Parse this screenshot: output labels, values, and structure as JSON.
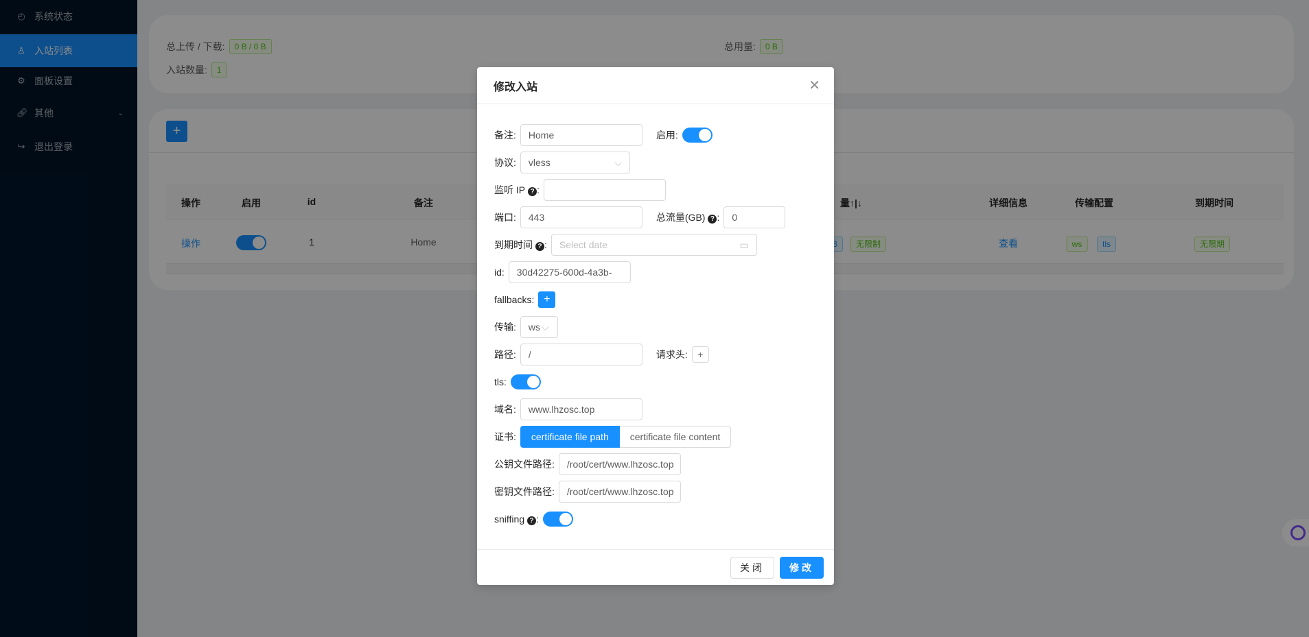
{
  "sidebar": {
    "items": [
      {
        "label": "系统状态",
        "icon": "dashboard-icon"
      },
      {
        "label": "入站列表",
        "icon": "user-icon",
        "selected": true
      },
      {
        "label": "面板设置",
        "icon": "gear-icon"
      },
      {
        "label": "其他",
        "icon": "link-icon"
      },
      {
        "label": "退出登录",
        "icon": "logout-icon"
      }
    ]
  },
  "stats": {
    "updown_label": "总上传 / 下载:",
    "updown_value": "0 B / 0 B",
    "count_label": "入站数量:",
    "count_value": "1",
    "total_label": "总用量:",
    "total_value": "0 B"
  },
  "table": {
    "headers": [
      "操作",
      "启用",
      "id",
      "备注",
      "量↑|↓",
      "详细信息",
      "传输配置",
      "到期时间"
    ],
    "row": {
      "action": "操作",
      "enabled": true,
      "id": "1",
      "remark": "Home",
      "traffic": "B",
      "limit": "无限制",
      "detail": "查看",
      "transport": "ws",
      "tls": "tls",
      "expiry": "无限期"
    }
  },
  "modal": {
    "title": "修改入站",
    "remark_label": "备注:",
    "remark": "Home",
    "enable_label": "启用:",
    "enabled": true,
    "protocol_label": "协议:",
    "protocol": "vless",
    "listen_label": "监听 IP",
    "listen": "",
    "port_label": "端口:",
    "port": "443",
    "total_label": "总流量(GB)",
    "total": "0",
    "expiry_label": "到期时间",
    "expiry_placeholder": "Select date",
    "id_label": "id:",
    "id": "30d42275-600d-4a3b-",
    "fallbacks_label": "fallbacks:",
    "transport_label": "传输:",
    "transport": "ws",
    "path_label": "路径:",
    "path": "/",
    "header_label": "请求头:",
    "tls_label": "tls:",
    "tls": true,
    "domain_label": "域名:",
    "domain": "www.lhzosc.top",
    "cert_label": "证书:",
    "cert_options": [
      "certificate file path",
      "certificate file content"
    ],
    "pubkey_label": "公钥文件路径:",
    "pubkey": "/root/cert/www.lhzosc.top",
    "privkey_label": "密钥文件路径:",
    "privkey": "/root/cert/www.lhzosc.top",
    "sniffing_label": "sniffing",
    "sniffing": true,
    "close_label": "关闭",
    "submit_label": "修改"
  },
  "colors": {
    "primary": "#1890ff",
    "sidebar": "#001529"
  }
}
